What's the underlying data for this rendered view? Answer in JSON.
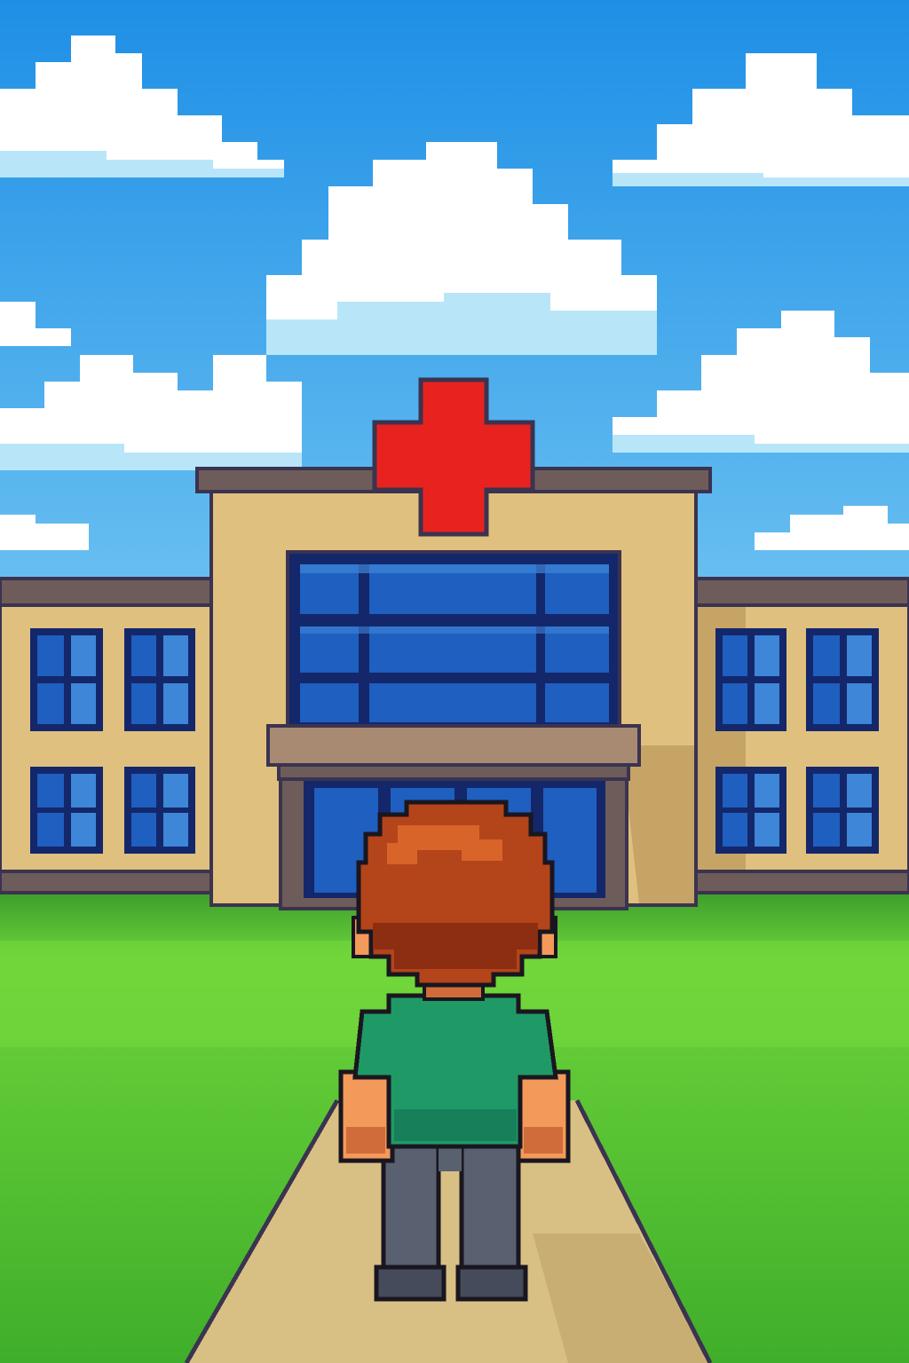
{
  "scene": {
    "setting": "hospital-exterior",
    "style": "pixel-art",
    "palette": {
      "sky_top": "#1e8fe6",
      "sky_bottom": "#8fd8f6",
      "cloud": "#ffffff",
      "cloud_shade": "#b8e6f8",
      "grass_near": "#3fae2a",
      "grass_mid": "#6cd33a",
      "grass_far": "#3a9a2a",
      "building_wall": "#e0c07e",
      "building_shadow": "#c6a466",
      "roof_trim": "#6e5c5a",
      "outline": "#3b3350",
      "window_frame": "#14276b",
      "window_glass": "#1f5fbf",
      "window_light": "#3d86d8",
      "red_cross": "#e8231f",
      "path": "#d8c084",
      "hair": "#b4441a",
      "shirt": "#1f9a66",
      "skin": "#f39a5a",
      "pants": "#596070"
    },
    "icons": [
      "red-cross-icon"
    ]
  }
}
